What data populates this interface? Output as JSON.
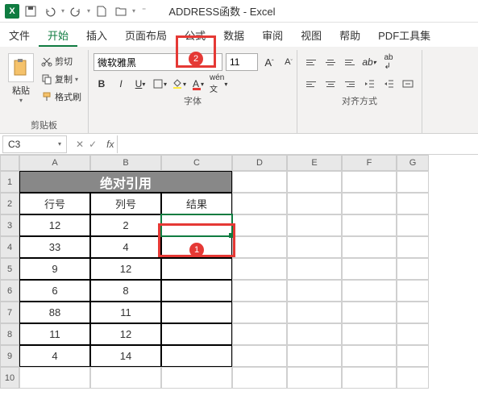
{
  "title": "ADDRESS函数 - Excel",
  "qat": {
    "save": "💾",
    "undo": "↶",
    "redo": "↷"
  },
  "menu": {
    "file": "文件",
    "home": "开始",
    "insert": "插入",
    "layout": "页面布局",
    "formulas": "公式",
    "data": "数据",
    "review": "审阅",
    "view": "视图",
    "help": "帮助",
    "pdf": "PDF工具集"
  },
  "ribbon": {
    "clipboard": {
      "paste": "粘贴",
      "cut": "剪切",
      "copy": "复制",
      "painter": "格式刷",
      "label": "剪贴板"
    },
    "font": {
      "name": "微软雅黑",
      "size": "11",
      "label": "字体"
    },
    "align": {
      "label": "对齐方式"
    }
  },
  "namebox": "C3",
  "columns": [
    "A",
    "B",
    "C",
    "D",
    "E",
    "F",
    "G"
  ],
  "rows": [
    "1",
    "2",
    "3",
    "4",
    "5",
    "6",
    "7",
    "8",
    "9",
    "10"
  ],
  "sheet": {
    "title": "绝对引用",
    "headers": {
      "row": "行号",
      "col": "列号",
      "result": "结果"
    },
    "data": [
      {
        "row": "12",
        "col": "2"
      },
      {
        "row": "33",
        "col": "4"
      },
      {
        "row": "9",
        "col": "12"
      },
      {
        "row": "6",
        "col": "8"
      },
      {
        "row": "88",
        "col": "11"
      },
      {
        "row": "11",
        "col": "12"
      },
      {
        "row": "4",
        "col": "14"
      }
    ]
  },
  "annotations": {
    "badge1": "1",
    "badge2": "2"
  }
}
